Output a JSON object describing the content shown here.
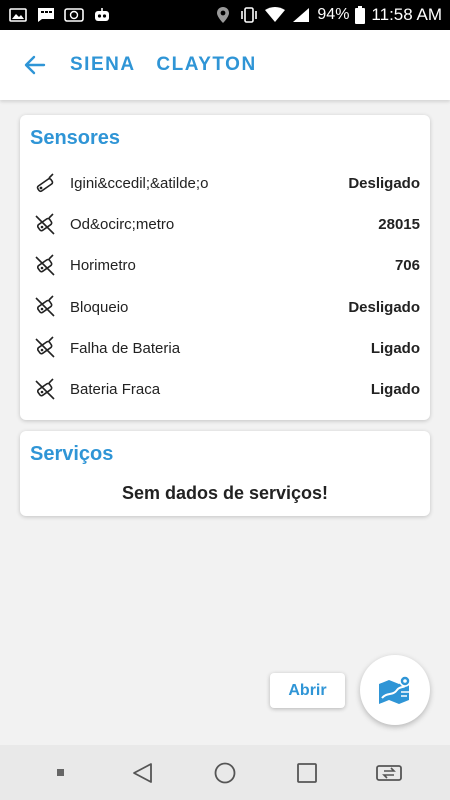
{
  "status_bar": {
    "battery": "94%",
    "time": "11:58 AM"
  },
  "app_bar": {
    "title": "SIENA  CLAYTON"
  },
  "sensores": {
    "title": "Sensores",
    "items": [
      {
        "label": "Igini&ccedil;&atilde;o",
        "value": "Desligado",
        "icon": "ignition-key-icon"
      },
      {
        "label": "Od&ocirc;metro",
        "value": "28015",
        "icon": "sensor-cross-icon"
      },
      {
        "label": "Horimetro",
        "value": "706",
        "icon": "sensor-cross-icon"
      },
      {
        "label": "Bloqueio",
        "value": "Desligado",
        "icon": "sensor-cross-icon"
      },
      {
        "label": "Falha de Bateria",
        "value": "Ligado",
        "icon": "sensor-cross-icon"
      },
      {
        "label": "Bateria Fraca",
        "value": "Ligado",
        "icon": "sensor-cross-icon"
      }
    ]
  },
  "servicos": {
    "title": "Serviços",
    "empty_message": "Sem dados de serviços!"
  },
  "actions": {
    "abrir_label": "Abrir",
    "fab_icon": "route-map-icon"
  },
  "colors": {
    "accent": "#2f95d6",
    "background": "#f2f2f2",
    "status_bar": "#000000"
  }
}
